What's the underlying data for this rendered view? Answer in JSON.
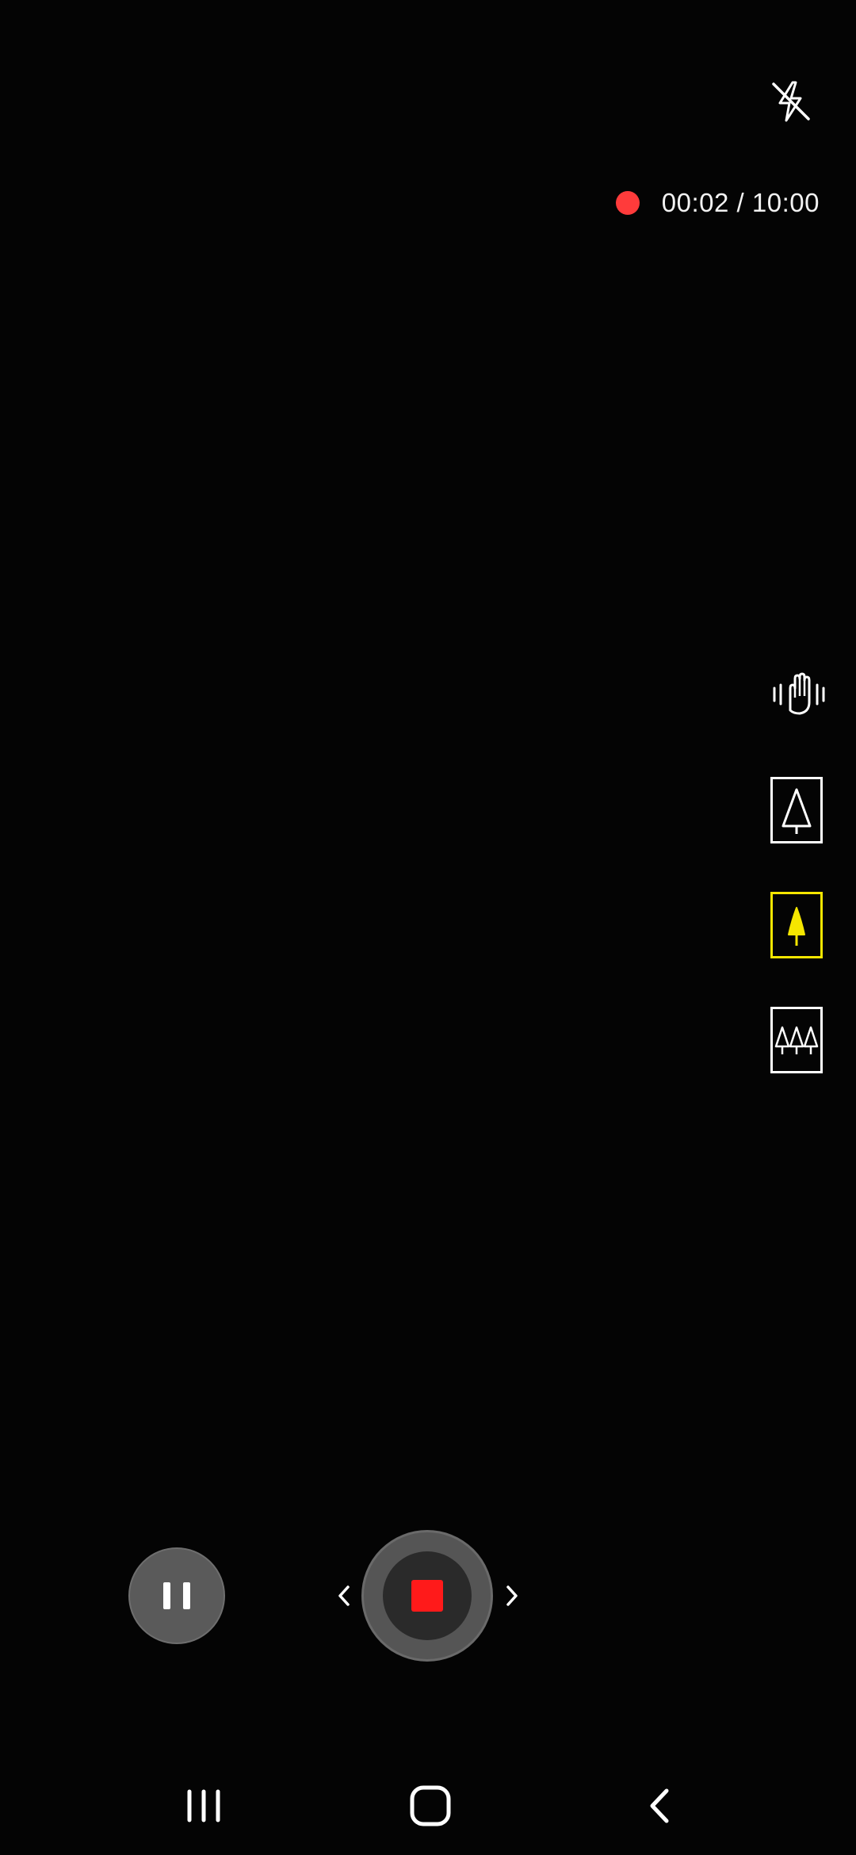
{
  "camera": {
    "recording": {
      "elapsed": "00:02",
      "separator": " / ",
      "limit": "10:00",
      "indicator_color": "#ff3b3b"
    },
    "flash": {
      "icon": "flash-off-icon",
      "state": "off"
    },
    "side_controls": {
      "stabilization_icon": "hand-shake-stabilization-icon",
      "zoom_options": [
        {
          "icon": "single-tree-outline-icon",
          "active": false
        },
        {
          "icon": "single-tree-filled-icon",
          "active": true
        },
        {
          "icon": "three-trees-icon",
          "active": false
        }
      ],
      "active_color": "#f5e600"
    },
    "controls": {
      "pause_icon": "pause-icon",
      "stop_icon": "stop-icon",
      "stop_color": "#ff1a1a",
      "prev_icon": "chevron-left-icon",
      "next_icon": "chevron-right-icon"
    }
  },
  "navbar": {
    "recents_icon": "recents-icon",
    "home_icon": "home-icon",
    "back_icon": "back-icon"
  }
}
